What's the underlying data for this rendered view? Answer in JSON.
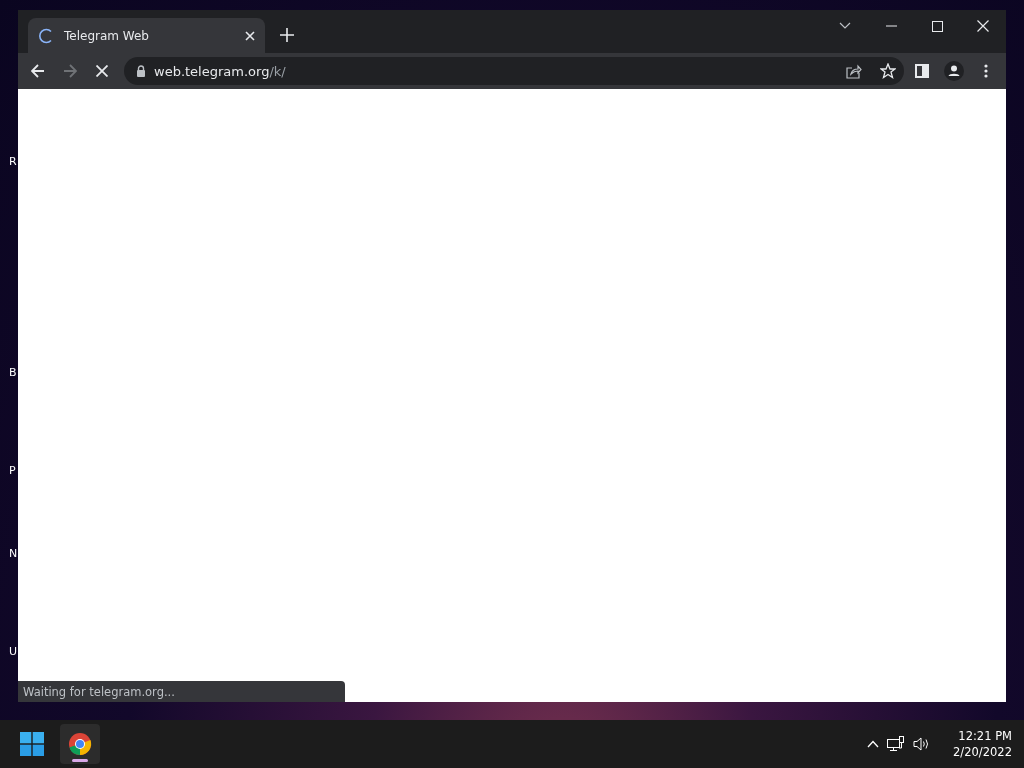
{
  "desktop_icons": [
    {
      "label": "R"
    },
    {
      "label": "B"
    },
    {
      "label": "P"
    },
    {
      "label": "N"
    },
    {
      "label": "U"
    }
  ],
  "browser": {
    "tabs": [
      {
        "title": "Telegram Web",
        "loading": true,
        "selected": true
      }
    ],
    "address": {
      "host": "web.telegram.org",
      "path": "/k/"
    },
    "loading": true,
    "status_bubble": "Waiting for telegram.org..."
  },
  "taskbar": {
    "apps": [
      {
        "kind": "chrome",
        "running": true
      }
    ],
    "time": "12:21 PM",
    "date": "2/20/2022"
  }
}
